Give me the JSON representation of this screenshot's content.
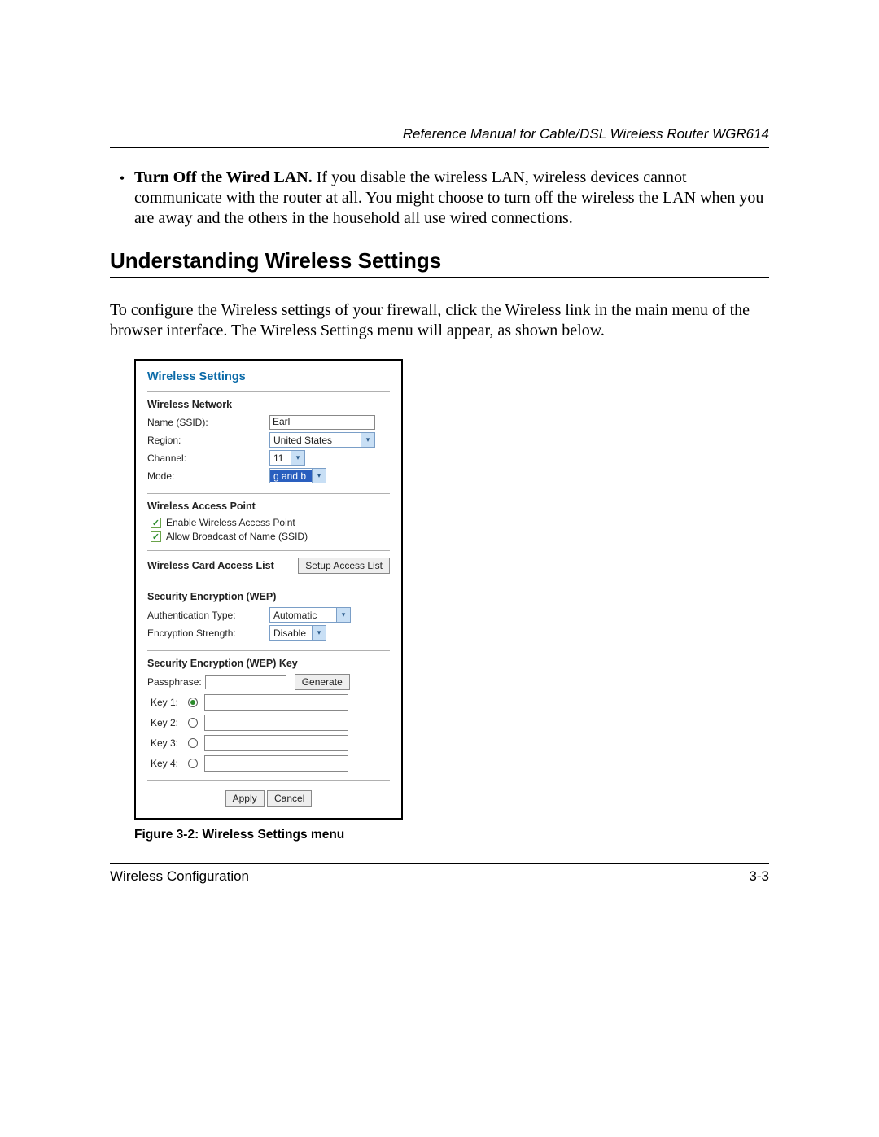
{
  "header": {
    "manual_title": "Reference Manual for Cable/DSL Wireless Router WGR614"
  },
  "bullet": {
    "lead": "Turn Off the Wired LAN.",
    "rest": " If you disable the wireless LAN, wireless devices cannot communicate with the router at all. You might choose to turn off the wireless the LAN when you are away and the others in the household all use wired connections."
  },
  "section_heading": "Understanding Wireless Settings",
  "intro_para": "To configure the Wireless settings of your firewall, click the Wireless link in the main menu of the browser interface. The Wireless Settings menu will appear, as shown below.",
  "panel": {
    "title": "Wireless Settings",
    "network": {
      "heading": "Wireless Network",
      "ssid_label": "Name (SSID):",
      "ssid_value": "Earl",
      "region_label": "Region:",
      "region_value": "United States",
      "channel_label": "Channel:",
      "channel_value": "11",
      "mode_label": "Mode:",
      "mode_value": "g and b"
    },
    "ap": {
      "heading": "Wireless Access Point",
      "enable_label": "Enable Wireless Access Point",
      "broadcast_label": "Allow Broadcast of Name (SSID)"
    },
    "acl": {
      "heading": "Wireless Card Access List",
      "button": "Setup Access List"
    },
    "wep": {
      "heading": "Security Encryption (WEP)",
      "auth_label": "Authentication Type:",
      "auth_value": "Automatic",
      "strength_label": "Encryption Strength:",
      "strength_value": "Disable"
    },
    "wep_key": {
      "heading": "Security Encryption (WEP) Key",
      "passphrase_label": "Passphrase:",
      "generate": "Generate",
      "key1": "Key 1:",
      "key2": "Key 2:",
      "key3": "Key 3:",
      "key4": "Key 4:"
    },
    "buttons": {
      "apply": "Apply",
      "cancel": "Cancel"
    }
  },
  "figure_caption": "Figure 3-2:  Wireless Settings menu",
  "footer": {
    "left": "Wireless Configuration",
    "right": "3-3"
  }
}
